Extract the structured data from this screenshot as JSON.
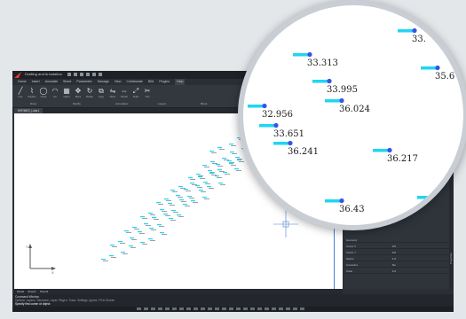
{
  "titlebar": {
    "file_title": "Drafting and Annotation",
    "app_title": "ARES Commander 2024"
  },
  "menu": {
    "items": [
      "Home",
      "Insert",
      "Annotate",
      "Sheet",
      "Parametric",
      "Manage",
      "View",
      "Collaborate",
      "BIM",
      "Plugins",
      "Help"
    ],
    "active_index": 10
  },
  "ribbon": {
    "tools": [
      "Line",
      "Polyline",
      "Circle",
      "Arc",
      "Hatch",
      "Move",
      "Rotate",
      "Copy",
      "Mirror",
      "Stretch",
      "Scale",
      "Trim"
    ],
    "groups": [
      "Draw",
      "Modify",
      "Annotation",
      "Layers",
      "Block"
    ]
  },
  "document_tab": "HERMES_Lidar1",
  "model_tabs": [
    "Model",
    "Sheet1",
    "Sheet2"
  ],
  "properties": [
    {
      "key": "Geometry",
      "value": ""
    },
    {
      "key": "Center X",
      "value": "0.0"
    },
    {
      "key": "Center Y",
      "value": "0.0"
    },
    {
      "key": "Radius",
      "value": "1.0"
    },
    {
      "key": "Annotative",
      "value": "No"
    },
    {
      "key": "Scale",
      "value": "1.0"
    }
  ],
  "side_panel_label": "Properties",
  "command": {
    "title": "Command Window",
    "line2": "Options: Layers, Tolerance, Layer, Regen, Trace, Settings, Ignore, Fit to Screen",
    "line3": "Specify first corner of object"
  },
  "magnified_labels": [
    "33.313",
    "33.995",
    "36.024",
    "32.956",
    "33.651",
    "36.241",
    "36.217",
    "36.43",
    "33.",
    "35.6",
    "33."
  ],
  "colors": {
    "app_bg": "#2b2f35",
    "canvas": "#ffffff",
    "marker": "#1fd6f2",
    "marker_dot": "#3a52e6",
    "accent_blue": "#4b7fd6"
  }
}
